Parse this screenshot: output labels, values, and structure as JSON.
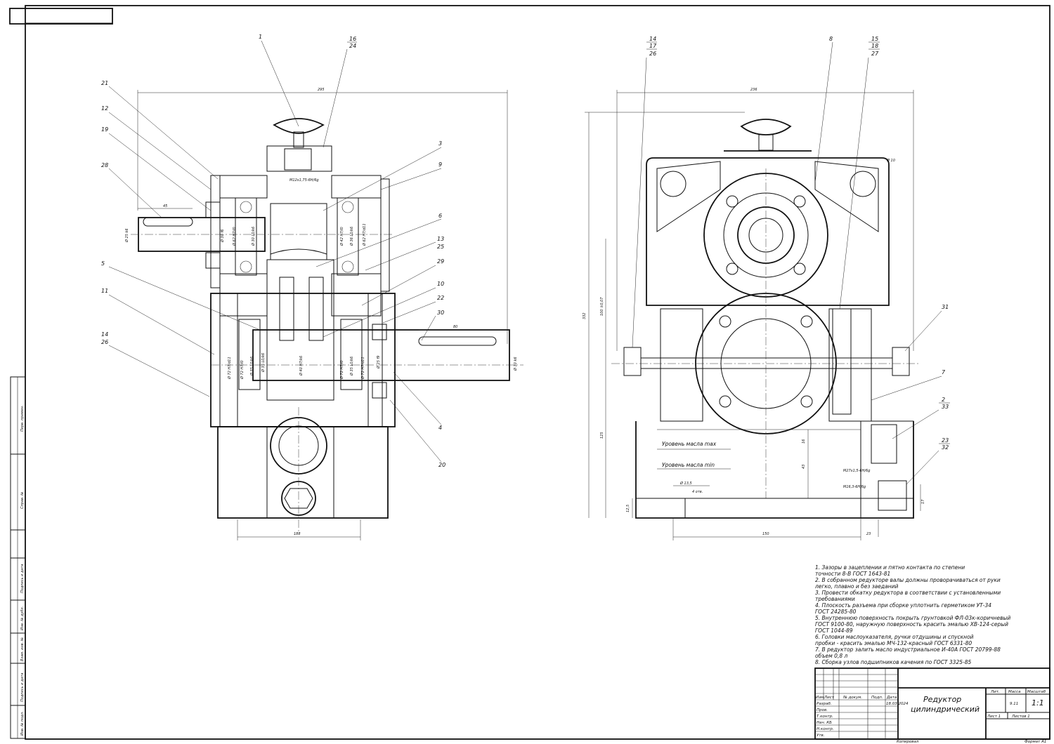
{
  "drawing": {
    "title_line1": "Редуктор",
    "title_line2": "цилиндрический",
    "sheet_number": "9.11",
    "scale": "1:1",
    "sheet_label": "Лист 1",
    "sheets_label": "Листов 1",
    "copied": "Копировал",
    "format": "Формат А1",
    "date_value": "18.03.2024"
  },
  "title_block": {
    "col_izm": "Изм.",
    "col_list": "Лист",
    "col_doc": "№ докум.",
    "col_sign": "Подп.",
    "col_date": "Дата",
    "razrab": "Разраб.",
    "prov": "Пров.",
    "tkontr": "Т.контр.",
    "nach": "Нач. КБ",
    "nkontr": "Н.контр.",
    "utv": "Утв.",
    "lit": "Лит.",
    "massa": "Масса",
    "masshtab": "Масштаб"
  },
  "side_stamp": {
    "perv": "Перв. примен.",
    "sprav": "Справ. №",
    "podp1": "Подпись и дата",
    "inv_dubl": "Инв. № дубл.",
    "vzam": "Взам. инв. №",
    "podp2": "Подпись и дата",
    "inv_podl": "Инв. № подл."
  },
  "notes": [
    "1. Зазоры в зацеплении и пятно контакта по степени",
    "    точности 8-В ГОСТ 1643-81",
    "2. В собранном редукторе валы должны проворачиваться от руки",
    "    легко, плавно и без заеданий",
    "3. Провести обкатку редуктора в соответствии с установленными",
    "    требованиями",
    "4. Плоскость разъема при сборке уплотнить герметиком УТ-34",
    "    ГОСТ 24285-80",
    "5. Внутреннюю поверхность покрыть грунтовкой ФЛ-03к-коричневый",
    "    ГОСТ 9100-80, наружную поверхность красить эмалью ХВ-124-серый",
    "    ГОСТ 1044-89",
    "6. Головки маслоуказателя, ручки отдушины и спускной",
    "    пробки - красить эмалью МЧ-132-красный ГОСТ 6331-80",
    "7. В редуктор залить масло индустриальное И-40А ГОСТ 20799-88",
    "    объем 0,8 л",
    "8. Сборка узлов подшипников качения по ГОСТ 3325-85"
  ],
  "left_view": {
    "dim_total": "295",
    "dim_shaft_in": "45",
    "dim_shaft_out": "80",
    "dim_bottom": "188",
    "thread": "М12х1,75-6Н/6g",
    "positions": [
      "1",
      "16",
      "24",
      "21",
      "12",
      "19",
      "28",
      "3",
      "9",
      "6",
      "13",
      "25",
      "5",
      "29",
      "10",
      "22",
      "30",
      "11",
      "14",
      "26",
      "4",
      "20"
    ],
    "fits_left": [
      "Ø 25 k6",
      "Ø 30 k6"
    ],
    "fits_in": [
      "Ø 30 f6",
      "Ø 62 H7/l0",
      "Ø 30 L0/k6",
      "Ø 42 H7/l0",
      "Ø 36 L0/k6",
      "Ø 62 H7/d11"
    ],
    "fits_out": [
      "Ø 72 H7/d11",
      "Ø 72 H7/l0",
      "Ø 35 L0/k6",
      "Ø 35 L0/k6",
      "Ø 40 H7/k6",
      "Ø 72 H7/l0",
      "Ø 35 L0/k6",
      "Ø 72 H7/d11",
      "Ø 25 f9"
    ]
  },
  "right_view": {
    "dim_width": "236",
    "dim_height": "332",
    "dim_center": "100 ±0,07",
    "dim_lower": "125",
    "dim_base": "150",
    "dim_side": "23",
    "dim_17": "17",
    "dim_43": "43",
    "dim_16": "16",
    "dim_12": "12,5",
    "hole": "Ø 13,5",
    "hole_count": "4 отв.",
    "bore": "Ø 10",
    "oil_max": "Уровень масла max",
    "oil_min": "Уровень масла min",
    "thread1": "М27х1,5-6Н/6g",
    "thread2": "М16,3-6Н/6g",
    "positions": [
      "14",
      "17",
      "26",
      "8",
      "15",
      "18",
      "27",
      "31",
      "7",
      "2",
      "33",
      "23",
      "32"
    ]
  }
}
